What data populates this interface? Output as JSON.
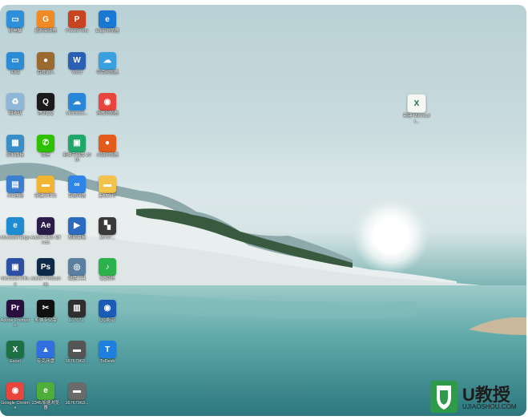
{
  "desktop_icons": [
    {
      "label": "此电脑",
      "icon": "monitor-icon",
      "color": "#2f8fd8",
      "glyph": "▭"
    },
    {
      "label": "福昕阅读器",
      "icon": "foxit-pdf-icon",
      "color": "#f08a24",
      "glyph": "G"
    },
    {
      "label": "PowerPoint",
      "icon": "powerpoint-icon",
      "color": "#c8431f",
      "glyph": "P"
    },
    {
      "label": "Edge浏览器",
      "icon": "ie-edge-icon",
      "color": "#1a78d2",
      "glyph": "e"
    },
    {
      "label": "网络",
      "icon": "network-icon",
      "color": "#2b8bd6",
      "glyph": "▭"
    },
    {
      "label": "百度输入",
      "icon": "acorn-icon",
      "color": "#9a6a2e",
      "glyph": "●"
    },
    {
      "label": "Word",
      "icon": "word-icon",
      "color": "#2b5fb4",
      "glyph": "W"
    },
    {
      "label": "夸克浏览器",
      "icon": "weather-icon",
      "color": "#3aa0e0",
      "glyph": "☁"
    },
    {
      "label": "回收站",
      "icon": "recycle-bin-icon",
      "color": "#8fb8d8",
      "glyph": "♻"
    },
    {
      "label": "腾讯QQ",
      "icon": "qq-icon",
      "color": "#1b1b1b",
      "glyph": "Q"
    },
    {
      "label": "Microsoft...",
      "icon": "onedrive-icon",
      "color": "#2a87d8",
      "glyph": "☁"
    },
    {
      "label": "谷歌浏览器",
      "icon": "chrome-icon",
      "color": "#e8453c",
      "glyph": "◉"
    },
    {
      "label": "控制面板",
      "icon": "control-panel-icon",
      "color": "#3b8fc9",
      "glyph": "▦"
    },
    {
      "label": "微信",
      "icon": "wechat-icon",
      "color": "#2dc100",
      "glyph": "✆"
    },
    {
      "label": "剪映专业版 2016",
      "icon": "green-app-icon",
      "color": "#1fa86a",
      "glyph": "▣"
    },
    {
      "label": "火狐浏览器",
      "icon": "firefox-icon",
      "color": "#e25b1b",
      "glyph": "●"
    },
    {
      "label": "360压缩",
      "icon": "archive-icon",
      "color": "#3b7fd0",
      "glyph": "▤"
    },
    {
      "label": "新建文件夹",
      "icon": "folder-icon",
      "color": "#f2b531",
      "glyph": "▬"
    },
    {
      "label": "百度网盘",
      "icon": "baidu-netdisk-icon",
      "color": "#2f86e8",
      "glyph": "∞"
    },
    {
      "label": "素材文件",
      "icon": "folder-icon",
      "color": "#f2c24a",
      "glyph": "▬"
    },
    {
      "label": "Microsoft Edge",
      "icon": "edge-icon",
      "color": "#1f8bd1",
      "glyph": "e"
    },
    {
      "label": "Adobe After Effects",
      "icon": "after-effects-icon",
      "color": "#2b1d4a",
      "glyph": "Ae"
    },
    {
      "label": "视频编辑",
      "icon": "video-icon",
      "color": "#2c6cc0",
      "glyph": "▶"
    },
    {
      "label": "16767...",
      "icon": "image-file-icon",
      "color": "#3a3a3a",
      "glyph": "▚"
    },
    {
      "label": "Microsoft Office",
      "icon": "office-icon",
      "color": "#2b4fa2",
      "glyph": "▣"
    },
    {
      "label": "Adobe Photoshop",
      "icon": "photoshop-icon",
      "color": "#0c2a4a",
      "glyph": "Ps"
    },
    {
      "label": "磁盘工具",
      "icon": "disk-tool-icon",
      "color": "#5a7fa0",
      "glyph": "◎"
    },
    {
      "label": "QQ音乐",
      "icon": "qq-music-icon",
      "color": "#2bb24c",
      "glyph": "♪"
    },
    {
      "label": "Adobe Premiere",
      "icon": "premiere-icon",
      "color": "#2a0f3e",
      "glyph": "Pr"
    },
    {
      "label": "剪映专业版",
      "icon": "capcut-icon",
      "color": "#111111",
      "glyph": "✂"
    },
    {
      "label": "16767...",
      "icon": "image-file-icon",
      "color": "#2f2f2f",
      "glyph": "▥"
    },
    {
      "label": "QQ影音",
      "icon": "qq-player-icon",
      "color": "#1a5bb5",
      "glyph": "◉"
    },
    {
      "label": "Excel",
      "icon": "excel-icon",
      "color": "#1d7044",
      "glyph": "X"
    },
    {
      "label": "夸克网盘",
      "icon": "cloud-drive-icon",
      "color": "#2f6fe0",
      "glyph": "▲"
    },
    {
      "label": "16767963...",
      "icon": "image-file-icon",
      "color": "#555555",
      "glyph": "▬"
    },
    {
      "label": "ToDesk",
      "icon": "todesk-icon",
      "color": "#1f7fe0",
      "glyph": "T"
    },
    {
      "label": "Google Chrome",
      "icon": "chrome-icon",
      "color": "#e8453c",
      "glyph": "◉"
    },
    {
      "label": "2345加速浏览器",
      "icon": "browser-icon",
      "color": "#4fae3a",
      "glyph": "e"
    },
    {
      "label": "16767963...",
      "icon": "image-file-icon",
      "color": "#6a6a6a",
      "glyph": "▬"
    }
  ],
  "file_icon": {
    "label": "新建 Microsoft...",
    "icon": "excel-file-icon",
    "color": "#1d7044",
    "glyph": "X"
  },
  "watermark": {
    "text": "U教授",
    "url": "UJIAOSHOU.COM"
  }
}
